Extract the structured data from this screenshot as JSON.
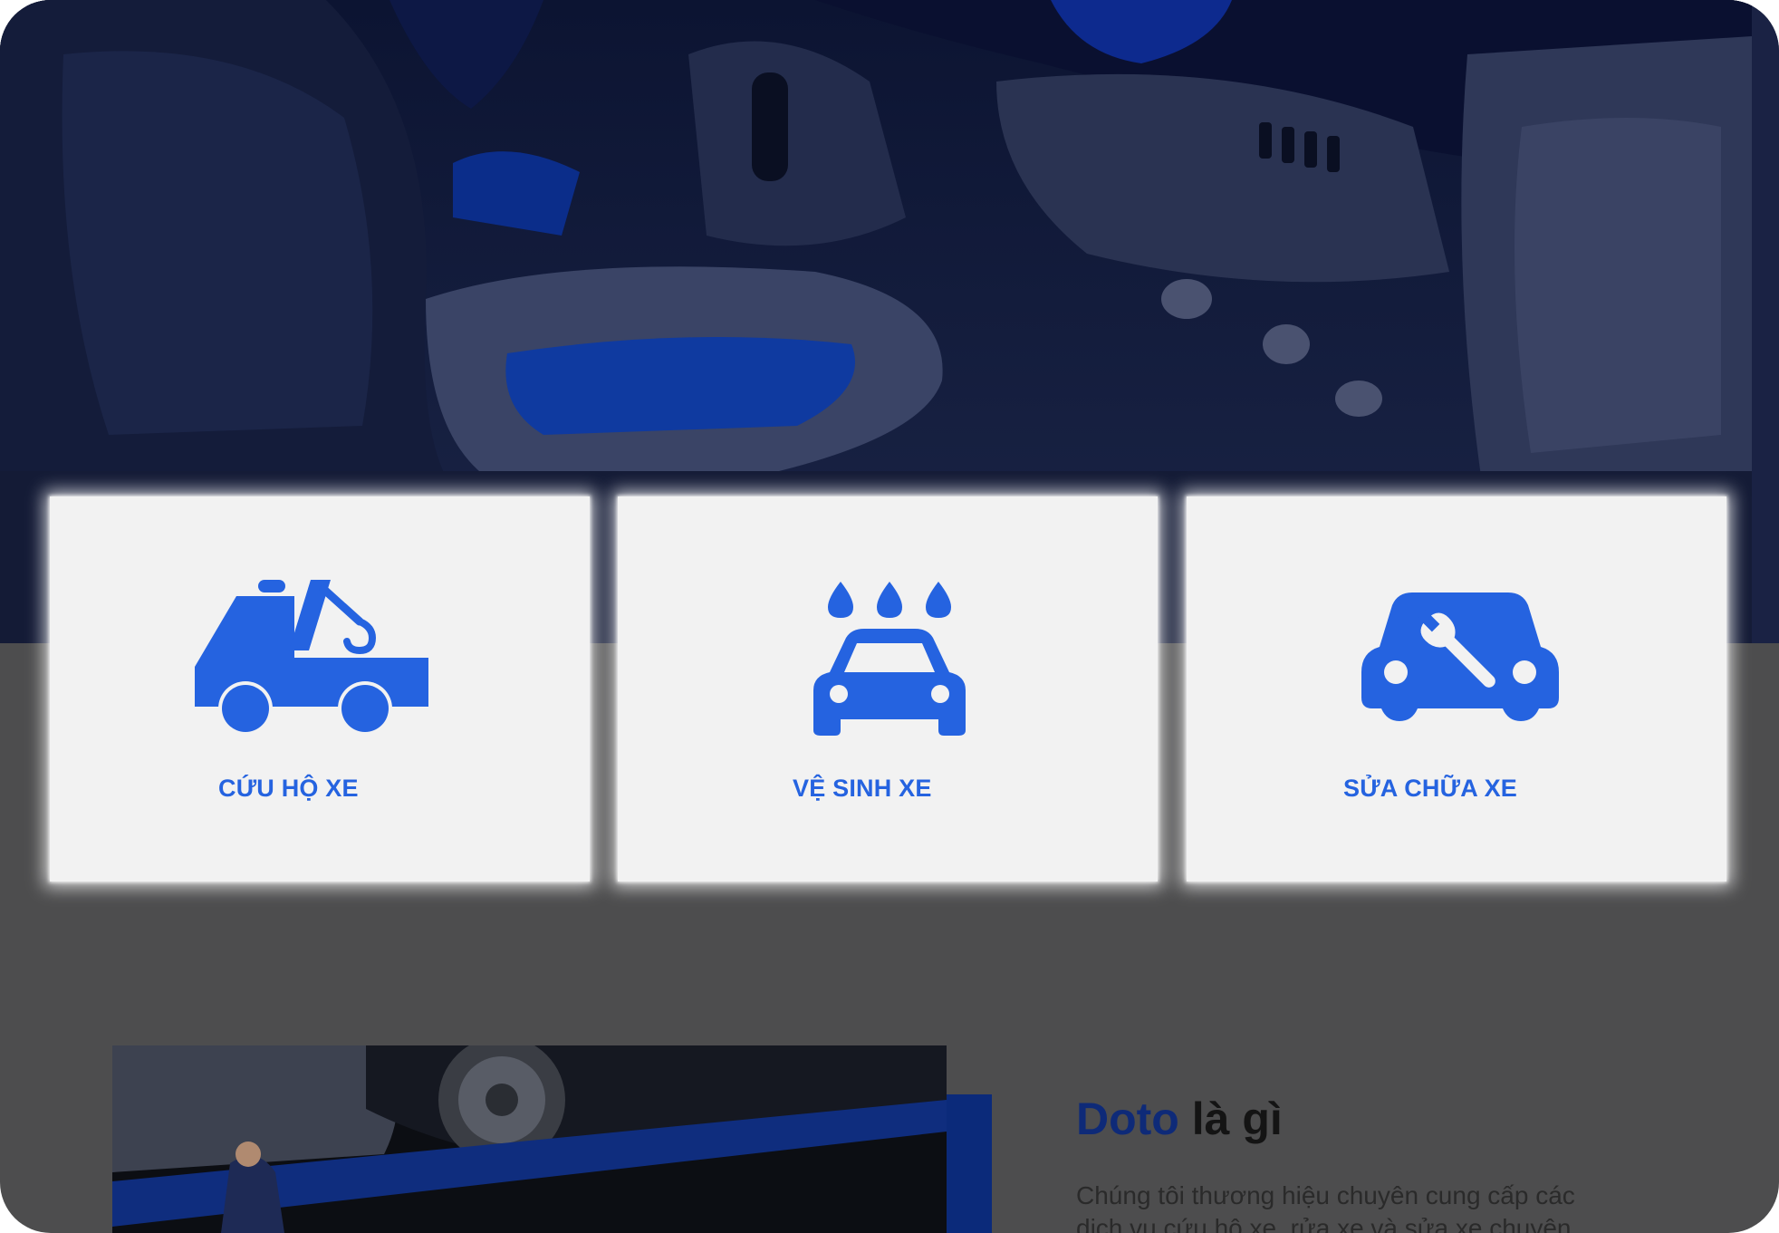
{
  "colors": {
    "accent": "#2563e0",
    "brand_dark": "#0e2a78",
    "card_bg": "#f2f2f2",
    "page_bg": "#4d4d4e",
    "hero_bg": "#151d38"
  },
  "hero": {
    "image": "car-interior-photo"
  },
  "services": [
    {
      "icon": "tow-truck-icon",
      "label": "CỨU HỘ XE"
    },
    {
      "icon": "car-wash-icon",
      "label": "VỆ SINH XE"
    },
    {
      "icon": "car-repair-icon",
      "label": "SỬA CHỮA XE"
    }
  ],
  "about": {
    "image": "mechanic-under-car-photo",
    "title_brand": "Doto",
    "title_rest": "là gì",
    "text": "Chúng tôi thương hiệu chuyên cung cấp các dịch vụ cứu hộ xe, rửa xe và sửa xe chuyên"
  }
}
